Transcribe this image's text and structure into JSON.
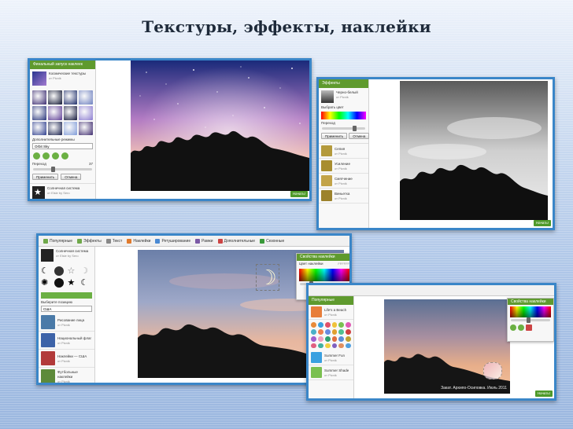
{
  "slide": {
    "title": "Текстуры, эффекты, наклейки"
  },
  "shot1": {
    "panel_header": "Финальный запуск наклеек",
    "category_name": "Космические текстуры",
    "category_author": "от Picnik",
    "dropdown_label": "Дополнительные режимы",
    "dropdown_value": "Orbit Sky",
    "slider_label": "Переход",
    "slider_value": "37",
    "apply_button": "Применить",
    "cancel_button": "Отмена",
    "item_name": "Солнечная система",
    "item_author": "от Elsie by Sero",
    "confirm_label": "Начать!",
    "thumb_colors": [
      "#3a2a70",
      "#0d1330",
      "#1d2d6a",
      "#6c7fbf",
      "#27337a",
      "#5c3c94",
      "#11163a",
      "#8a7bd0",
      "#2f3f8f",
      "#151d4b",
      "#7f9bd8",
      "#3e2b6e"
    ],
    "photo": {
      "sky_top": "#1a2a7a",
      "sky_mid": "#b27bc3",
      "sky_low": "#f3c4b6"
    }
  },
  "shot2": {
    "panel_header": "Эффекты",
    "effect_name": "Черно-белый",
    "effect_author": "от Picnik",
    "tone_label": "Выбрать цвет",
    "slider_label": "Переход",
    "apply_button": "Применить",
    "cancel_button": "Отмена",
    "list": [
      {
        "name": "Сепия",
        "author": "от Picnik"
      },
      {
        "name": "Усиление",
        "author": "от Picnik"
      },
      {
        "name": "Смягчение",
        "author": "от Picnik"
      },
      {
        "name": "Виньетка",
        "author": "от Picnik"
      }
    ],
    "confirm_label": "Начать!",
    "list_colors": [
      "#b49a3c",
      "#a88d2f",
      "#c2a348",
      "#9c822c"
    ]
  },
  "shot3": {
    "tabs": [
      "Популярные",
      "Эффекты",
      "Текст",
      "Наклейки",
      "Ретуширование",
      "Рамки",
      "Дополнительные",
      "Сезонные"
    ],
    "tab_colors": [
      "#6fa84a",
      "#6fa84a",
      "#888888",
      "#e07a2c",
      "#4a8ad4",
      "#7b5aa6",
      "#cc4444",
      "#3a9a3a"
    ],
    "item_name": "Солнечная система",
    "item_author": "от Elsie by Sero",
    "dropdown_label": "Выберите позицию",
    "dropdown_value": "США",
    "list": [
      {
        "name": "Рисование лица",
        "author": "от Picnik"
      },
      {
        "name": "Национальный флаг",
        "author": "от Picnik"
      },
      {
        "name": "Наклейки — США",
        "author": "от Picnik"
      },
      {
        "name": "Футбольные наклейки",
        "author": "от Picnik"
      }
    ],
    "list_colors": [
      "#4a7aa8",
      "#3d63a8",
      "#b23a3a",
      "#5d8a3a"
    ],
    "palette_header": "Свойства наклейки",
    "palette_color_label": "Цвет наклейки",
    "palette_value": "FFFFFF",
    "confirm_label": "Начать!"
  },
  "shot4": {
    "panel_header": "Популярные",
    "list_top": {
      "name": "Life's a Beach",
      "author": "от Picnik"
    },
    "list_bottom": [
      {
        "name": "Summer Fun",
        "author": "от Picnik"
      },
      {
        "name": "Summer Shade",
        "author": "от Picnik"
      }
    ],
    "watermark": "Закат. Архипо-Осиповка. Июль 2011",
    "palette_header": "Свойства наклейки",
    "confirm_label": "Начать!",
    "sticker_colors": [
      "#e88a3a",
      "#3aa0e0",
      "#e0506a",
      "#f0c23a",
      "#7ac050",
      "#e05ab4",
      "#4ab0c8",
      "#f08050",
      "#6a8ae0",
      "#e0a030",
      "#50c090",
      "#d04040",
      "#a060d0",
      "#f0a0c0",
      "#30a070",
      "#e07040",
      "#5a90d8",
      "#c0a030",
      "#e06080",
      "#40b0a0",
      "#f0d040",
      "#8060c0",
      "#e09060",
      "#50a0e0"
    ]
  }
}
